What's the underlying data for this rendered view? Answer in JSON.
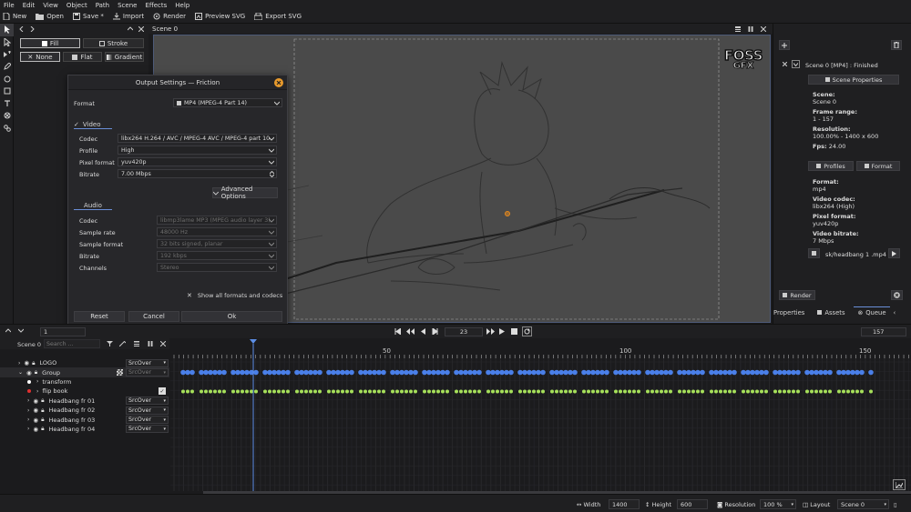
{
  "menu": [
    "File",
    "Edit",
    "View",
    "Object",
    "Path",
    "Scene",
    "Effects",
    "Help"
  ],
  "toolbar": {
    "new": "New",
    "open": "Open",
    "save": "Save *",
    "import": "Import",
    "render": "Render",
    "preview_svg": "Preview SVG",
    "export_svg": "Export SVG"
  },
  "fill_panel": {
    "fill": "Fill",
    "stroke": "Stroke",
    "none": "None",
    "flat": "Flat",
    "gradient": "Gradient"
  },
  "scene_tab": "Scene 0",
  "logo": {
    "line1": "FOSS",
    "line2": "GFX"
  },
  "dialog": {
    "title": "Output Settings — Friction",
    "format_label": "Format",
    "format_value": "MP4 (MPEG-4 Part 14)",
    "video_section": "Video",
    "codec_label": "Codec",
    "codec_value": "libx264 H.264 / AVC / MPEG-4 AVC / MPEG-4 part 10",
    "profile_label": "Profile",
    "profile_value": "High",
    "pixfmt_label": "Pixel format",
    "pixfmt_value": "yuv420p",
    "bitrate_label": "Bitrate",
    "bitrate_value": "7.00 Mbps",
    "advanced": "Advanced Options",
    "audio_section": "Audio",
    "acodec_label": "Codec",
    "acodec_value": "libmp3lame MP3 (MPEG audio layer 3)",
    "samplerate_label": "Sample rate",
    "samplerate_value": "48000 Hz",
    "sampleformat_label": "Sample format",
    "sampleformat_value": "32 bits signed, planar",
    "abitrate_label": "Bitrate",
    "abitrate_value": "192 kbps",
    "channels_label": "Channels",
    "channels_value": "Stereo",
    "show_all": "Show all formats and codecs",
    "reset": "Reset",
    "cancel": "Cancel",
    "ok": "Ok"
  },
  "right_panel": {
    "queue_item": "Scene 0 [MP4] : Finished",
    "scene_props": "Scene Properties",
    "scene_k": "Scene:",
    "scene_v": "Scene 0",
    "range_k": "Frame range:",
    "range_v": "1 - 157",
    "res_k": "Resolution:",
    "res_v": "100.00% - 1400 x 600",
    "fps_k": "Fps:",
    "fps_v": "24.00",
    "profiles": "Profiles",
    "format": "Format",
    "fmt_k": "Format:",
    "fmt_v": "mp4",
    "vcodec_k": "Video codec:",
    "vcodec_v": "libx264 (High)",
    "pix_k": "Pixel format:",
    "pix_v": "yuv420p",
    "vbit_k": "Video bitrate:",
    "vbit_v": "7 Mbps",
    "output": "sk/headbang 1 .mp4",
    "render": "Render",
    "tabs": [
      "Properties",
      "Assets",
      "Queue"
    ]
  },
  "playback": {
    "start": "1",
    "current": "23",
    "end": "157"
  },
  "timeline": {
    "scene": "Scene 0",
    "search_placeholder": "Search ...",
    "ruler": [
      "50",
      "100",
      "150"
    ],
    "layers": [
      {
        "name": "LOGO",
        "blend": "SrcOver"
      },
      {
        "name": "Group",
        "blend": "SrcOver"
      },
      {
        "name": "transform",
        "blend": ""
      },
      {
        "name": "flip book",
        "blend": ""
      },
      {
        "name": "Headbang fr 01",
        "blend": "SrcOver"
      },
      {
        "name": "Headbang fr 02",
        "blend": "SrcOver"
      },
      {
        "name": "Headbang fr 03",
        "blend": "SrcOver"
      },
      {
        "name": "Headbang fr 04",
        "blend": "SrcOver"
      }
    ]
  },
  "status": {
    "width_label": "Width",
    "width": "1400",
    "height_label": "Height",
    "height": "600",
    "res_label": "Resolution",
    "res": "100 %",
    "layout_label": "Layout",
    "layout": "Scene 0"
  },
  "colors": {
    "accent": "#4a7fe8",
    "key_blue": "#4a7fe8",
    "key_green": "#a6e05a",
    "playhead": "#5c8ee6",
    "close_orange": "#e89a2c"
  }
}
